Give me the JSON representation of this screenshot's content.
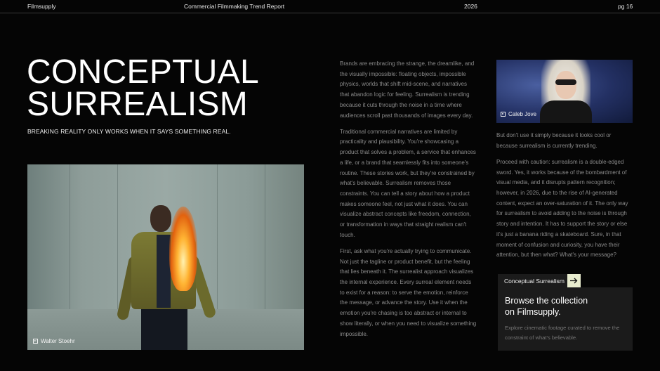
{
  "header": {
    "brand": "Filmsupply",
    "report_title": "Commercial Filmmaking Trend Report",
    "year": "2026",
    "page": "pg 16"
  },
  "hero": {
    "title_line1": "CONCEPTUAL",
    "title_line2": "SURREALISM",
    "subtitle": "BREAKING REALITY ONLY WORKS WHEN IT SAYS SOMETHING REAL."
  },
  "images": {
    "main_credit": "Walter Stoehr",
    "side_credit": "Caleb Jove"
  },
  "body_middle": [
    "Brands are embracing the strange, the dreamlike, and the visually impossible: floating objects, impossible physics, worlds that shift mid-scene, and narratives that abandon logic for feeling. Surrealism is trending because it cuts through the noise in a time where audiences scroll past thousands of images every day.",
    "Traditional commercial narratives are limited by practicality and plausibility. You're showcasing a product that solves a problem, a service that enhances a life, or a brand that seamlessly fits into someone's routine. These stories work, but they're constrained by what's believable. Surrealism removes those constraints. You can tell a story about how a product makes someone feel, not just what it does. You can visualize abstract concepts like freedom, connection, or transformation in ways that straight realism can't touch.",
    "First, ask what you're actually trying to communicate. Not just the tagline or product benefit, but the feeling that lies beneath it. The surrealist approach visualizes the internal experience. Every surreal element needs to exist for a reason: to serve the emotion, reinforce the message, or advance the story. Use it when the emotion you're chasing is too abstract or internal to show literally, or when you need to visualize something impossible."
  ],
  "body_right": [
    "But don't use it simply because it looks cool or because surrealism is currently trending.",
    "Proceed with caution: surrealism is a double-edged sword. Yes, it works because of the bombardment of visual media, and it disrupts pattern recognition; however, in 2026, due to the rise of AI-generated content, expect an over-saturation of it. The only way for surrealism to avoid adding to the noise is through story and intention. It has to support the story or else it's just a banana riding a skateboard. Sure, in that moment of confusion and curiosity, you have their attention, but then what? What's your message?"
  ],
  "cta": {
    "tag_label": "Conceptual Surrealism",
    "arrow_icon": "arrow-right-icon",
    "heading": "Browse the collection on Filmsupply.",
    "description": "Explore cinematic footage curated to remove the constraint of what's believable.",
    "accent_color": "#e8ecce"
  }
}
